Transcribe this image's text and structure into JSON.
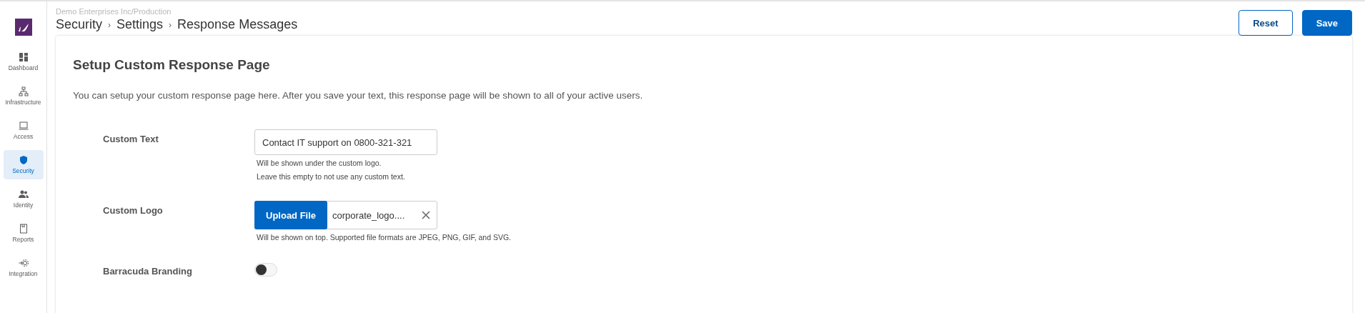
{
  "sidebar": {
    "items": [
      {
        "label": "Dashboard",
        "selected": false
      },
      {
        "label": "Infrastructure",
        "selected": false
      },
      {
        "label": "Access",
        "selected": false
      },
      {
        "label": "Security",
        "selected": true
      },
      {
        "label": "Identity",
        "selected": false
      },
      {
        "label": "Reports",
        "selected": false
      },
      {
        "label": "Integration",
        "selected": false
      }
    ]
  },
  "header": {
    "organization": "Demo Enterprises Inc/Production",
    "breadcrumb": [
      "Security",
      "Settings",
      "Response Messages"
    ],
    "separator": "›",
    "buttons": [
      {
        "label": "Reset",
        "kind": "secondary"
      },
      {
        "label": "Save",
        "kind": "primary"
      }
    ]
  },
  "card": {
    "title": "Setup Custom Response Page",
    "description": "You can setup your custom response page here. After you save your text, this response page will be shown to all of your active users.",
    "fields": [
      {
        "kind": "text",
        "label": "Custom Text",
        "value": "Contact IT support on 0800-321-321",
        "help": [
          "Will be shown under the custom logo.",
          "Leave this empty to not use any custom text."
        ]
      },
      {
        "kind": "file",
        "label": "Custom Logo",
        "button": "Upload File",
        "value": "corporate_logo....",
        "help": [
          "Will be shown on top. Supported file formats are JPEG, PNG, GIF, and SVG."
        ]
      },
      {
        "kind": "toggle",
        "label": "Barracuda Branding",
        "on": false
      }
    ]
  }
}
